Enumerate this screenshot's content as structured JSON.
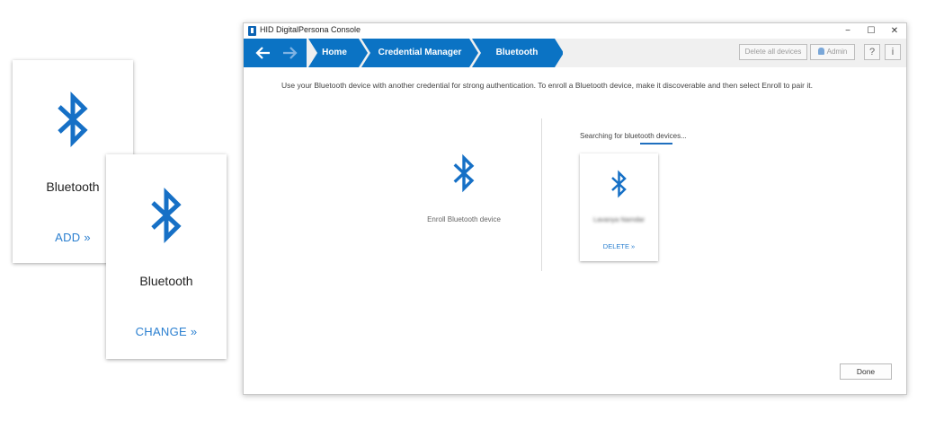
{
  "colors": {
    "accent": "#0b73c4",
    "link": "#2a7fd0",
    "icon": "#1670c6"
  },
  "cards": [
    {
      "title": "Bluetooth",
      "action": "ADD »",
      "icon": "bluetooth-icon"
    },
    {
      "title": "Bluetooth",
      "action": "CHANGE »",
      "icon": "bluetooth-icon"
    }
  ],
  "window": {
    "title": "HID DigitalPersona Console",
    "controls": {
      "minimize": "−",
      "maximize": "☐",
      "close": "✕"
    },
    "nav": {
      "back_icon": "arrow-left-icon",
      "forward_icon": "arrow-right-icon"
    },
    "breadcrumbs": [
      "Home",
      "Credential Manager",
      "Bluetooth"
    ],
    "toolbar": {
      "delete_all": "Delete all devices",
      "admin": "Admin",
      "help": "?",
      "info": "i"
    },
    "instructions": "Use your Bluetooth device with another credential for strong authentication. To enroll a Bluetooth device, make it discoverable and then select Enroll to pair it.",
    "enroll_label": "Enroll Bluetooth device",
    "search_text": "Searching for bluetooth devices...",
    "device": {
      "name": "Lavanya Namdar",
      "action": "DELETE »"
    },
    "done": "Done"
  }
}
